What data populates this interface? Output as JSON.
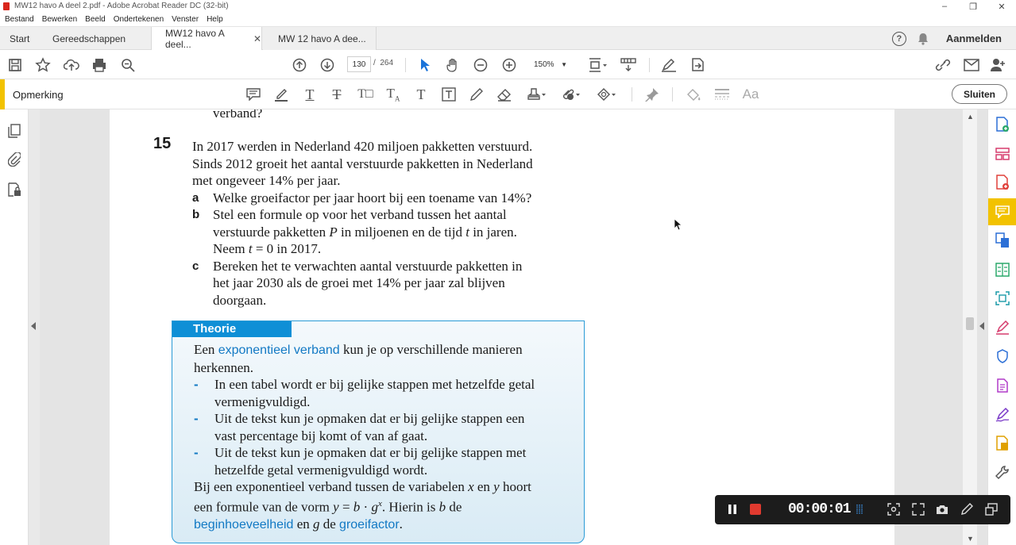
{
  "window": {
    "title": "MW12 havo A deel 2.pdf - Adobe Acrobat Reader DC (32-bit)"
  },
  "menu": [
    "Bestand",
    "Bewerken",
    "Beeld",
    "Ondertekenen",
    "Venster",
    "Help"
  ],
  "tabs": {
    "start": "Start",
    "tools": "Gereedschappen",
    "doc1": "MW12 havo A deel...",
    "doc2": "MW 12 havo A dee...",
    "signin": "Aanmelden"
  },
  "toolbar": {
    "page_current": "130",
    "page_separator": "/",
    "page_total": "264",
    "zoom": "150%"
  },
  "comment_bar": {
    "label": "Opmerking",
    "close": "Sluiten"
  },
  "document": {
    "prev_line": "verband?",
    "question_number": "15",
    "intro": [
      "In 2017 werden in Nederland 420 miljoen pakketten verstuurd.",
      "Sinds 2012 groeit het aantal verstuurde pakketten in Nederland",
      "met ongeveer 14% per jaar."
    ],
    "sub_a_letter": "a",
    "sub_a": "Welke groeifactor per jaar hoort bij een toename van 14%?",
    "sub_b_letter": "b",
    "sub_b_1": "Stel een formule op voor het verband tussen het aantal",
    "sub_b_2_pre": "verstuurde pakketten ",
    "sub_b_2_var": "P",
    "sub_b_2_mid": " in miljoenen en de tijd ",
    "sub_b_2_var2": "t",
    "sub_b_2_post": " in jaren.",
    "sub_b_3_pre": "Neem ",
    "sub_b_3_var": "t",
    "sub_b_3_post": " = 0 in 2017.",
    "sub_c_letter": "c",
    "sub_c_1": "Bereken het te verwachten aantal verstuurde pakketten in",
    "sub_c_2": "het jaar 2030 als de groei met 14% per jaar zal blijven",
    "sub_c_3": "doorgaan.",
    "theory": {
      "heading": "Theorie",
      "line1_pre": "Een ",
      "line1_kw": "exponentieel verband",
      "line1_post": " kun je op verschillende manieren",
      "line2": "herkennen.",
      "dash": "-",
      "bullet1_1": "In een tabel wordt er bij gelijke stappen met hetzelfde getal",
      "bullet1_2": "vermenigvuldigd.",
      "bullet2_1": "Uit de tekst kun je opmaken dat er bij gelijke stappen een",
      "bullet2_2": "vast percentage bij komt of van af gaat.",
      "bullet3_1": "Uit de tekst kun je opmaken dat er bij gelijke stappen met",
      "bullet3_2": "hetzelfde getal vermenigvuldigd wordt.",
      "p2_1_pre": "Bij een exponentieel verband tussen de variabelen ",
      "p2_1_x": "x",
      "p2_1_mid": " en ",
      "p2_1_y": "y",
      "p2_1_post": " hoort",
      "p2_2_pre": "een formule van de vorm ",
      "p2_2_formula_y": "y",
      "p2_2_formula_eq": " = ",
      "p2_2_formula_b": "b",
      "p2_2_formula_dot": " · ",
      "p2_2_formula_g": "g",
      "p2_2_formula_exp": "x",
      "p2_2_post_pre": ". Hierin is ",
      "p2_2_b": "b",
      "p2_2_post": " de",
      "p2_3_kw1": "beginhoeveelheid",
      "p2_3_mid": " en ",
      "p2_3_g": "g",
      "p2_3_de": " de ",
      "p2_3_kw2": "groeifactor",
      "p2_3_end": "."
    }
  },
  "recorder": {
    "timer": "00:00:01"
  },
  "colors": {
    "accent_yellow": "#f2c200",
    "theory_blue": "#0f8fd6",
    "keyword_blue": "#1279c4",
    "record_red": "#e03a2f"
  }
}
